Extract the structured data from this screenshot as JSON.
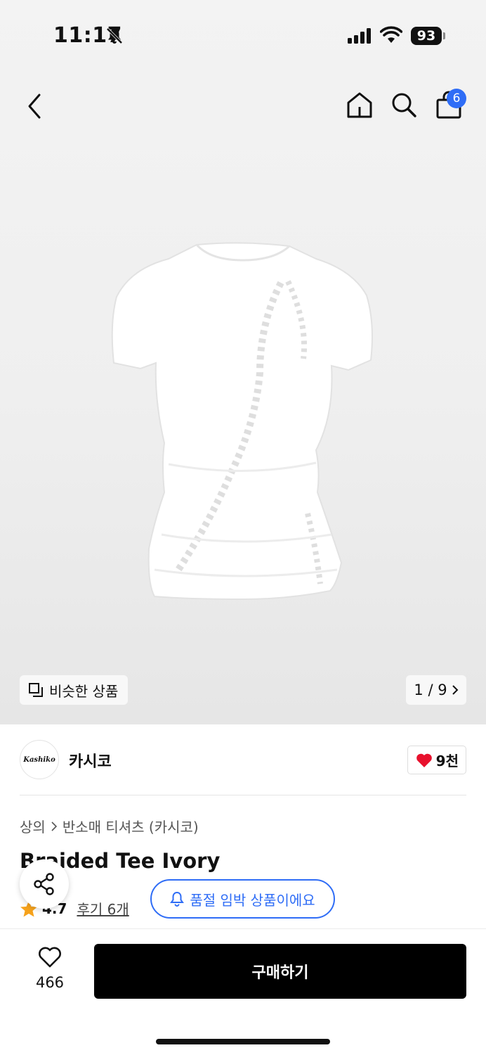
{
  "status_bar": {
    "time": "11:17",
    "battery": "93"
  },
  "nav": {
    "cart_count": "6"
  },
  "gallery": {
    "similar_label": "비슷한 상품",
    "pager": "1 / 9"
  },
  "brand": {
    "logo_text": "Kashiko",
    "name": "카시코",
    "likes": "9천"
  },
  "breadcrumb": {
    "category": "상의",
    "subcategory": "반소매 티셔츠 (카시코)"
  },
  "product": {
    "title": "Braided Tee Ivory",
    "rating": "4.7",
    "reviews": "후기 6개"
  },
  "banner": {
    "soldout_text": "품절 임박 상품이에요"
  },
  "bottom": {
    "wish_count": "466",
    "buy_label": "구매하기"
  },
  "colors": {
    "accent": "#2f6df6",
    "heart": "#e8112d",
    "star": "#f6a21b"
  },
  "icons": [
    "back-arrow-icon",
    "home-icon",
    "search-icon",
    "bag-icon",
    "similar-icon",
    "chevron-right-icon",
    "heart-icon",
    "star-icon",
    "share-icon",
    "bell-icon"
  ]
}
